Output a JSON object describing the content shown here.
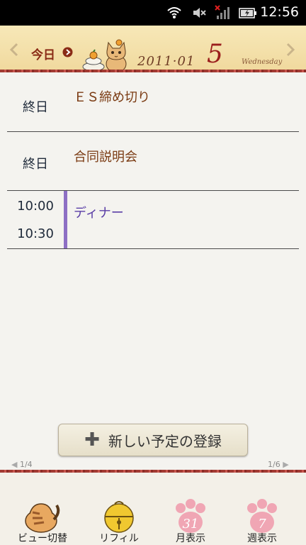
{
  "status_bar": {
    "time": "12:56"
  },
  "header": {
    "today_label": "今日",
    "year_month": "2011·01",
    "day": "5",
    "weekday": "Wednesday"
  },
  "events": [
    {
      "time": "終日",
      "title": "ＥＳ締め切り",
      "title_color": "#7a3a12"
    },
    {
      "time": "終日",
      "title": "合同説明会",
      "title_color": "#7a3a12"
    },
    {
      "start": "10:00",
      "end": "10:30",
      "title": "ディナー",
      "title_color": "#5a3ea6",
      "bar_color": "#8d6fc4"
    }
  ],
  "add_button": {
    "label": "新しい予定の登録"
  },
  "pagination": {
    "left": "1/4",
    "right": "1/6"
  },
  "toolbar": {
    "items": [
      {
        "label": "ビュー切替",
        "icon": "cat-icon"
      },
      {
        "label": "リフィル",
        "icon": "bell-icon"
      },
      {
        "label": "月表示",
        "icon": "paw-icon",
        "badge": "31"
      },
      {
        "label": "週表示",
        "icon": "paw-icon",
        "badge": "7"
      }
    ]
  }
}
